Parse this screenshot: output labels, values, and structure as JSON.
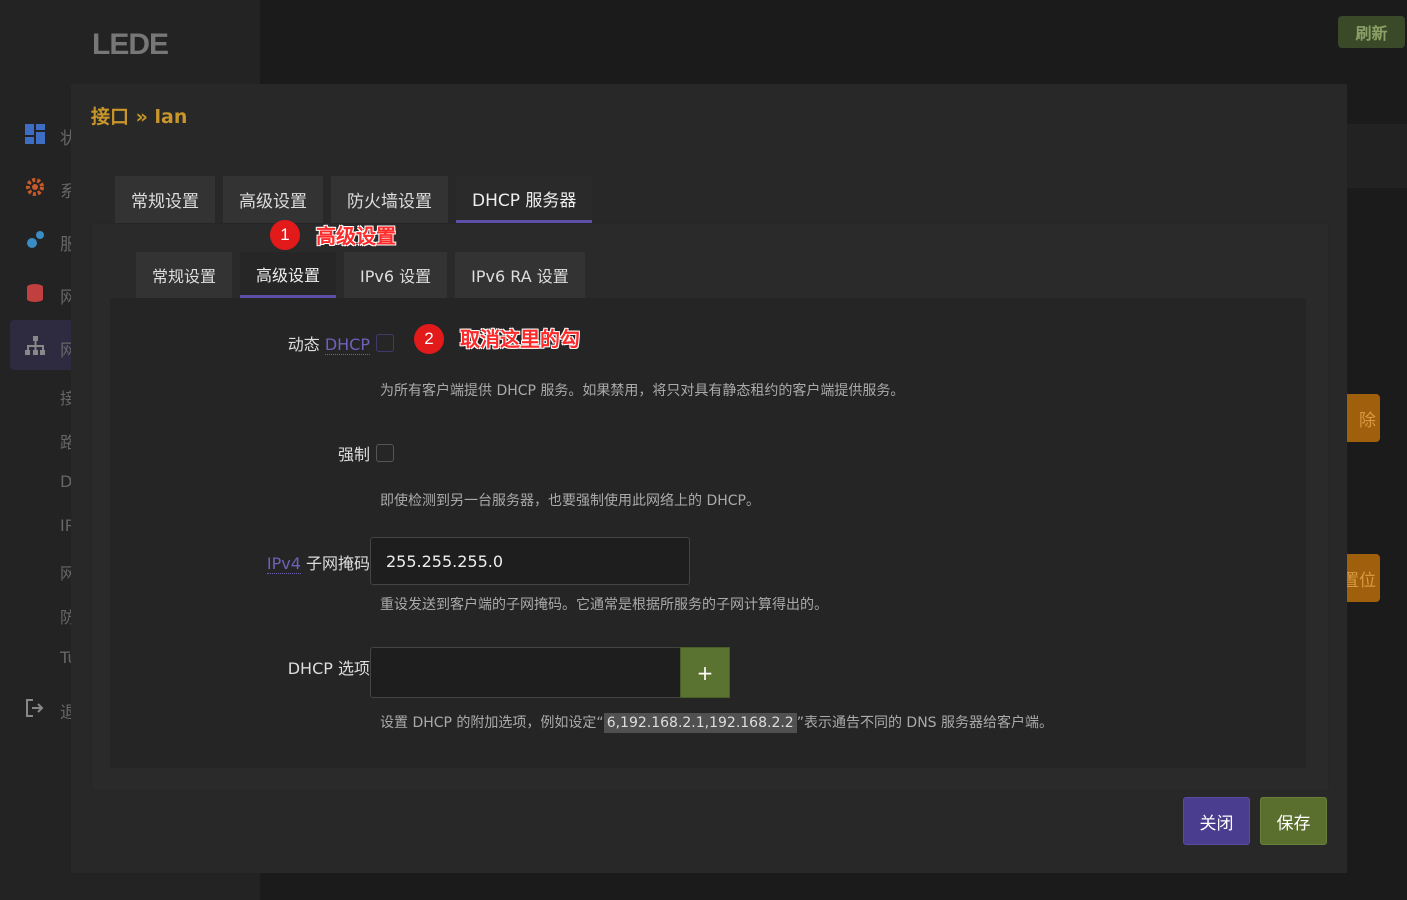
{
  "app": {
    "logo": "LEDE",
    "refresh_label": "刷新"
  },
  "sidebar": {
    "items": [
      {
        "icon": "dashboard-icon",
        "label": "状",
        "color": "#3d6ec4"
      },
      {
        "icon": "gear-icon",
        "label": "系",
        "color": "#c85a2a"
      },
      {
        "icon": "cogs-icon",
        "label": "服",
        "color": "#3a8cc4"
      },
      {
        "icon": "database-icon",
        "label": "网",
        "color": "#c04040"
      },
      {
        "icon": "network-icon",
        "label": "网",
        "color": "#888888"
      }
    ],
    "sub_items": [
      "接",
      "路",
      "D",
      "IP",
      "网",
      "防",
      "Tu"
    ],
    "logout": {
      "icon": "logout-icon",
      "label": "退"
    }
  },
  "background": {
    "delete_label": "除",
    "reset_label": "置位"
  },
  "modal": {
    "title": "接口 » lan",
    "tabs": [
      {
        "label": "常规设置",
        "active": false
      },
      {
        "label": "高级设置",
        "active": false
      },
      {
        "label": "防火墙设置",
        "active": false
      },
      {
        "label": "DHCP 服务器",
        "active": true
      }
    ],
    "subtabs": [
      {
        "label": "常规设置",
        "active": false
      },
      {
        "label": "高级设置",
        "active": true
      },
      {
        "label": "IPv6 设置",
        "active": false
      },
      {
        "label": "IPv6 RA 设置",
        "active": false
      }
    ],
    "fields": {
      "dynamic_dhcp": {
        "label_prefix": "动态 ",
        "label_abbr": "DHCP",
        "checked": false,
        "desc": "为所有客户端提供 DHCP 服务。如果禁用，将只对具有静态租约的客户端提供服务。"
      },
      "force": {
        "label": "强制",
        "checked": false,
        "desc": "即使检测到另一台服务器，也要强制使用此网络上的 DHCP。"
      },
      "netmask": {
        "label_abbr": "IPv4",
        "label_suffix": " 子网掩码",
        "value": "255.255.255.0",
        "desc": "重设发送到客户端的子网掩码。它通常是根据所服务的子网计算得出的。"
      },
      "dhcp_options": {
        "label": "DHCP 选项",
        "value": "",
        "add_label": "+",
        "desc_prefix": "设置 DHCP 的附加选项，例如设定“",
        "desc_code": "6,192.168.2.1,192.168.2.2",
        "desc_suffix": "”表示通告不同的 DNS 服务器给客户端。"
      }
    },
    "buttons": {
      "close": "关闭",
      "save": "保存"
    }
  },
  "annotations": [
    {
      "number": "1",
      "text": "高级设置"
    },
    {
      "number": "2",
      "text": "取消这里的勾"
    }
  ],
  "colors": {
    "accent": "#5d4ea8",
    "title": "#c8962a",
    "save": "#5a6f2e",
    "close": "#4a3d8f",
    "annotation": "#e21a1a"
  }
}
